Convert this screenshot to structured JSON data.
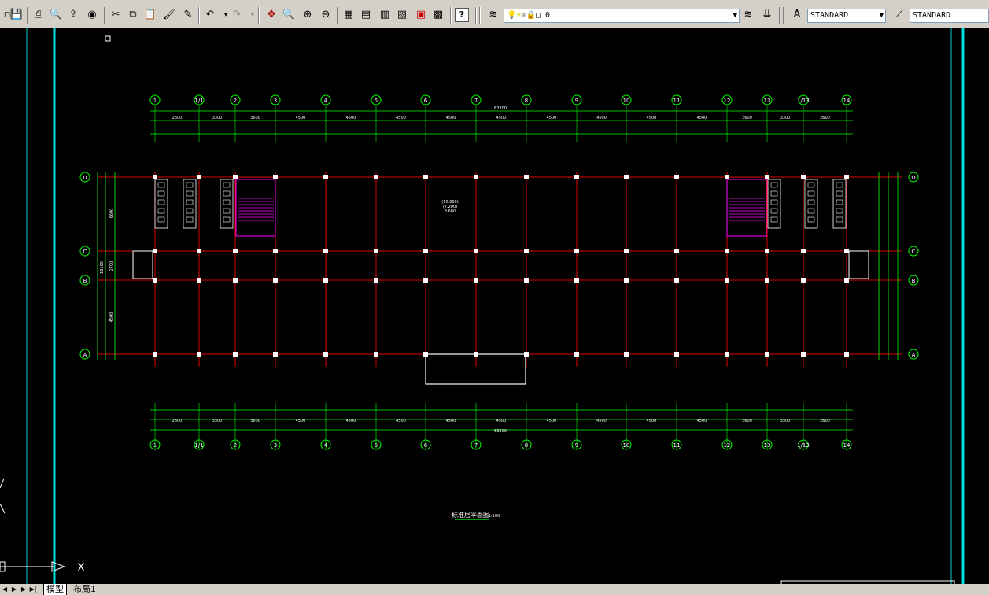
{
  "toolbar": {
    "layer_name": "0",
    "text_style": "STANDARD",
    "dim_style": "STANDARD"
  },
  "drawing": {
    "title": "标准层平面图",
    "scale": "1:100",
    "axis_x_label": "X",
    "axis_y_label": "Y",
    "column_labels": [
      "1",
      "1/1",
      "2",
      "3",
      "4",
      "5",
      "6",
      "7",
      "8",
      "9",
      "10",
      "11",
      "12",
      "13",
      "1/13",
      "14"
    ],
    "row_labels": [
      "D",
      "C",
      "B",
      "A"
    ],
    "total_width": "63300",
    "top_dims": [
      "2600",
      "3300",
      "3600",
      "4500",
      "4500",
      "4500",
      "4500",
      "4500",
      "4500",
      "4500",
      "4500",
      "4500",
      "3600",
      "3300",
      "2600"
    ],
    "bottom_total": "63300",
    "left_dims": [
      "6600",
      "2700",
      "4500"
    ],
    "left_total": "18100",
    "level_label": "(10.800)",
    "level_label2": "(7.200)",
    "level_label3": "3.600"
  },
  "tabs": {
    "model": "模型",
    "layout1": "布局1"
  }
}
